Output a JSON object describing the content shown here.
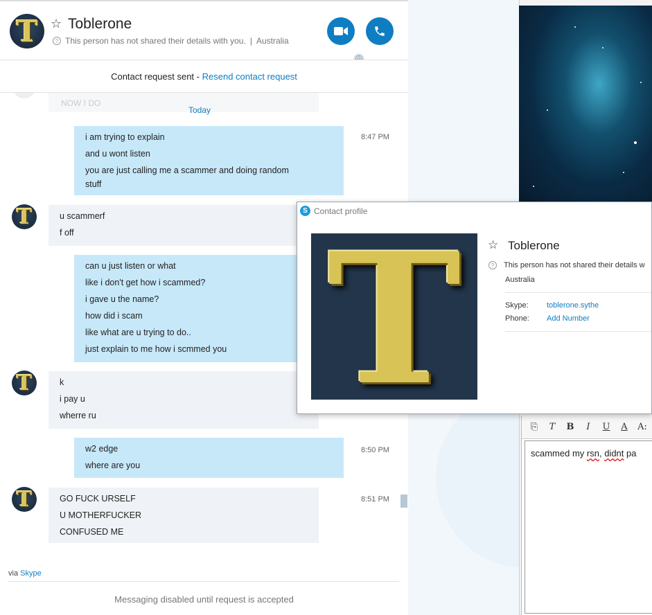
{
  "contact": {
    "name": "Toblerone",
    "details_notice": "This person has not shared their details with you.",
    "separator": "|",
    "location": "Australia",
    "avatar_letter": "T"
  },
  "request_bar": {
    "text": "Contact request sent - ",
    "link": "Resend contact request"
  },
  "ghost_text": "NOW I DO",
  "day_divider": "Today",
  "messages": [
    {
      "dir": "out",
      "time": "8:47 PM",
      "lines": [
        "i am trying to explain",
        "and u wont listen",
        "you are just calling me a scammer and doing random",
        "stuff"
      ]
    },
    {
      "dir": "in",
      "time": "",
      "lines": [
        "u scammerf",
        "f off"
      ]
    },
    {
      "dir": "out",
      "time": "",
      "lines": [
        "can u just listen or what",
        "like i don't get how i scammed?",
        "i gave u the name?",
        "how did i scam",
        "like what are u trying to do..",
        "just explain to me how i scmmed you"
      ]
    },
    {
      "dir": "in",
      "time": "",
      "lines": [
        "k",
        "i pay u",
        "wherre ru"
      ]
    },
    {
      "dir": "out",
      "time": "8:50 PM",
      "lines": [
        "w2 edge",
        "where are you"
      ]
    },
    {
      "dir": "in",
      "time": "8:51 PM",
      "lines": [
        "GO FUCK URSELF",
        "U MOTHERFUCKER",
        "CONFUSED ME"
      ]
    }
  ],
  "via": {
    "prefix": "via ",
    "link": "Skype"
  },
  "footer": "Messaging disabled until request is accepted",
  "profile": {
    "title": "Contact profile",
    "name": "Toblerone",
    "details_notice": "This person has not shared their details w",
    "location": "Australia",
    "skype_label": "Skype:",
    "skype_value": "toblerone.sythe",
    "phone_label": "Phone:",
    "phone_value": "Add Number"
  },
  "editor": {
    "text_before": "scammed my ",
    "misspelled_1": "rsn",
    "text_mid": ", ",
    "misspelled_2": "didnt",
    "text_after": " pa",
    "toolbar": [
      "B",
      "I",
      "U",
      "A",
      "A:"
    ]
  },
  "colors": {
    "accent": "#0f7dc2",
    "outgoing": "#c7e8f9",
    "incoming": "#eff2f6"
  },
  "icons": {
    "video": "video-camera-icon",
    "call": "phone-icon",
    "star": "star-outline-icon",
    "info": "question-circle-icon"
  }
}
